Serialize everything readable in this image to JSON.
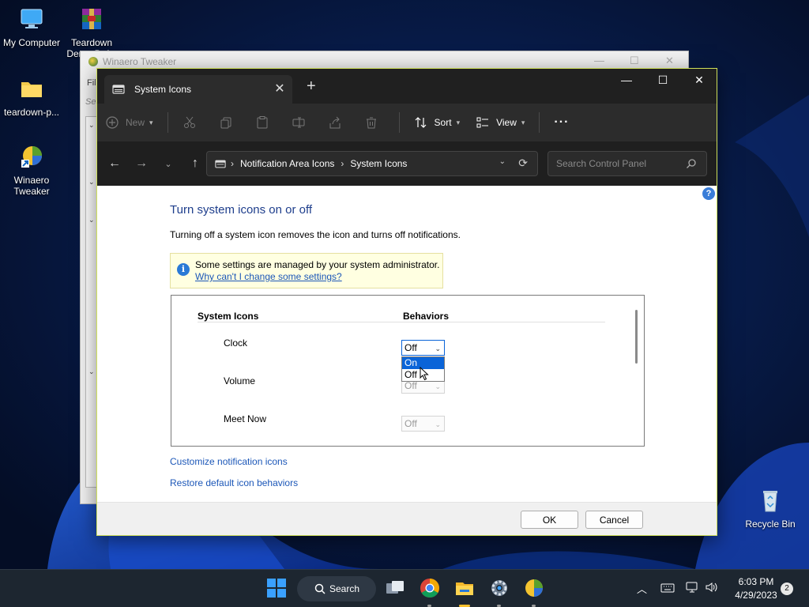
{
  "desktop": {
    "icons": [
      {
        "label": "My Computer",
        "icon": "computer-icon"
      },
      {
        "label": "Teardown",
        "label2": "Demo Bef...",
        "icon": "winrar-icon"
      },
      {
        "label": "teardown-p...",
        "icon": "folder-icon"
      },
      {
        "label": "Winaero",
        "label2": "Tweaker",
        "icon": "winaero-icon"
      },
      {
        "label": "Recycle Bin",
        "icon": "recycle-bin-icon"
      }
    ]
  },
  "background_window": {
    "title": "Winaero Tweaker",
    "side_texts": [
      "Fil",
      "Sea"
    ]
  },
  "explorer": {
    "tab_title": "System Icons",
    "toolbar": {
      "new_label": "New",
      "sort_label": "Sort",
      "view_label": "View",
      "more_label": "···"
    },
    "address": {
      "crumbs": [
        "Notification Area Icons",
        "System Icons"
      ]
    },
    "search": {
      "placeholder": "Search Control Panel"
    }
  },
  "content": {
    "title": "Turn system icons on or off",
    "description": "Turning off a system icon removes the icon and turns off notifications.",
    "info": {
      "text": "Some settings are managed by your system administrator.",
      "link": "Why can't I change some settings?"
    },
    "table": {
      "col1": "System Icons",
      "col2": "Behaviors",
      "rows": [
        {
          "name": "Clock",
          "value": "Off"
        },
        {
          "name": "Volume",
          "value": "Off"
        },
        {
          "name": "Meet Now",
          "value": "Off"
        }
      ],
      "dropdown_options": [
        "On",
        "Off"
      ],
      "highlighted_option": "On"
    },
    "links": {
      "customize": "Customize notification icons",
      "restore": "Restore default icon behaviors"
    },
    "buttons": {
      "ok": "OK",
      "cancel": "Cancel"
    }
  },
  "taskbar": {
    "search_label": "Search",
    "clock_time": "6:03 PM",
    "clock_date": "4/29/2023",
    "notification_count": "2"
  },
  "colors": {
    "accent": "#0a64d8",
    "link": "#1c57b8",
    "title_blue": "#1e3e8c",
    "info_bg": "#ffffe1"
  }
}
